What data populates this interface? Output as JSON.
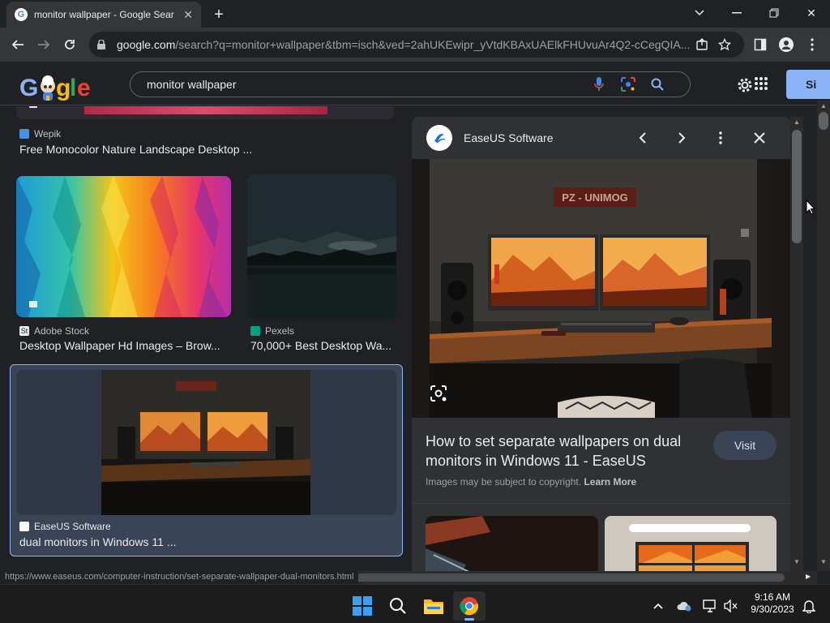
{
  "browser": {
    "tab_title": "monitor wallpaper - Google Sear",
    "url_host": "google.com",
    "url_rest": "/search?q=monitor+wallpaper&tbm=isch&ved=2ahUKEwipr_yVtdKBAxUAElkFHUvuAr4Q2-cCegQIA...",
    "status_url": "https://www.easeus.com/computer-instruction/set-separate-wallpaper-dual-monitors.html"
  },
  "search": {
    "query": "monitor wallpaper",
    "signin_label": "Si"
  },
  "results": [
    {
      "source": "Wepik",
      "title": "Free Monocolor Nature Landscape Desktop ..."
    },
    {
      "source": "Adobe Stock",
      "title": "Desktop Wallpaper Hd Images – Brow..."
    },
    {
      "source": "Pexels",
      "title": "70,000+ Best Desktop Wa..."
    },
    {
      "source": "EaseUS Software",
      "title": "dual monitors in Windows 11 ..."
    }
  ],
  "preview": {
    "site_name": "EaseUS Software",
    "title": "How to set separate wallpapers on dual monitors in Windows 11 - EaseUS",
    "visit_label": "Visit",
    "copyright_text": "Images may be subject to copyright.",
    "learn_more": "Learn More",
    "sign_text": "PZ - UNIMOG"
  },
  "taskbar": {
    "time": "9:16 AM",
    "date": "9/30/2023"
  },
  "colors": {
    "accent": "#8ab4f8",
    "selected_bg": "#394457",
    "panel_bg": "#303134",
    "page_bg": "#202124"
  }
}
